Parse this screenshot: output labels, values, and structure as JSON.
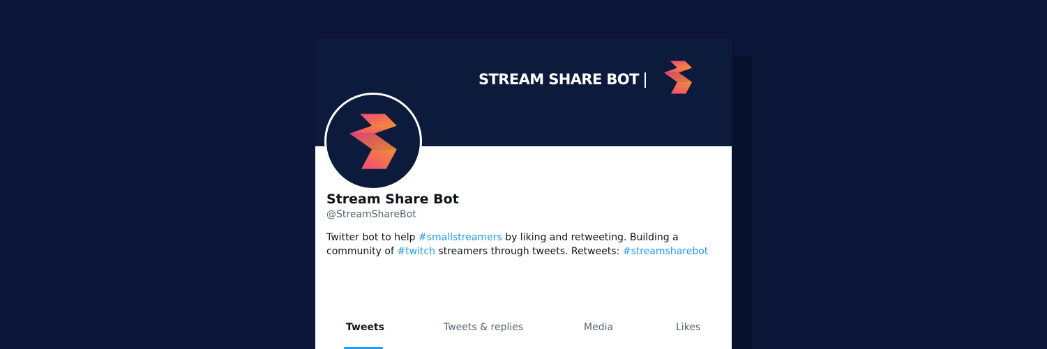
{
  "banner": {
    "brand_text": "STREAM SHARE BOT",
    "logo_icon": "stream-share-bot-logo"
  },
  "profile": {
    "display_name": "Stream Share Bot",
    "handle": "@StreamShareBot",
    "avatar_icon": "stream-share-bot-logo",
    "bio": {
      "part1": "Twitter bot to help ",
      "tag1": "#smallstreamers",
      "part2": " by liking and retweeting. Building a community of ",
      "tag2": "#twitch",
      "part3": " streamers through tweets. Retweets: ",
      "tag3": "#streamsharebot"
    }
  },
  "tabs": [
    {
      "label": "Tweets",
      "active": true
    },
    {
      "label": "Tweets & replies",
      "active": false
    },
    {
      "label": "Media",
      "active": false
    },
    {
      "label": "Likes",
      "active": false
    }
  ],
  "colors": {
    "page_background": "#0b1638",
    "banner_background": "#0c1a3b",
    "link": "#1d9bf0",
    "text_primary": "#0f1419",
    "text_secondary": "#536471",
    "logo_gradient_start": "#f2497a",
    "logo_gradient_end": "#f39033"
  }
}
